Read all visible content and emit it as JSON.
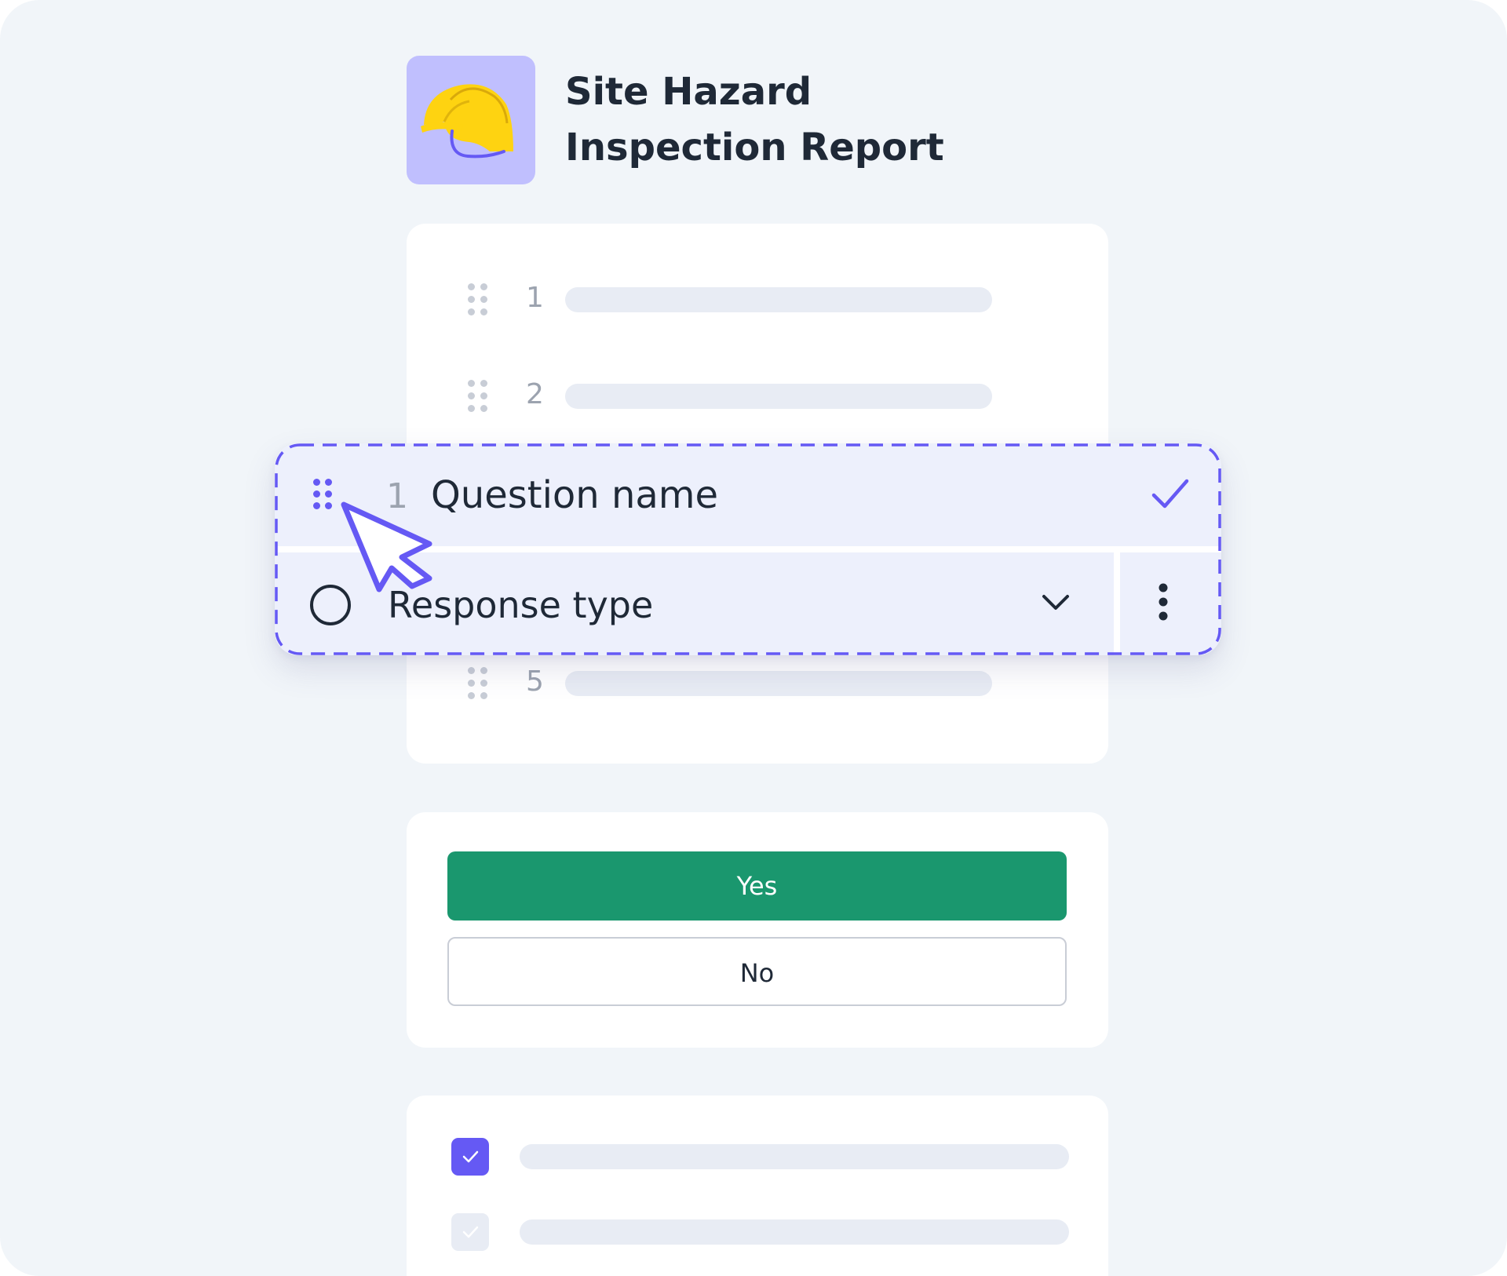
{
  "header": {
    "title_line1": "Site Hazard",
    "title_line2": "Inspection Report",
    "icon": "hard-hat-icon",
    "icon_bg_color": "#c0bffe"
  },
  "question_list": {
    "rows": [
      {
        "number": "1"
      },
      {
        "number": "2"
      },
      {
        "number": "5"
      }
    ]
  },
  "dragged_question": {
    "number": "1",
    "question_name": "Question name",
    "response_type": "Response type"
  },
  "response_options": {
    "yes_label": "Yes",
    "no_label": "No",
    "yes_color": "#1a976e"
  },
  "checklist": {
    "items": [
      {
        "checked": true
      },
      {
        "checked": false
      }
    ]
  },
  "colors": {
    "accent": "#6559f4",
    "background": "#f1f5f9"
  }
}
